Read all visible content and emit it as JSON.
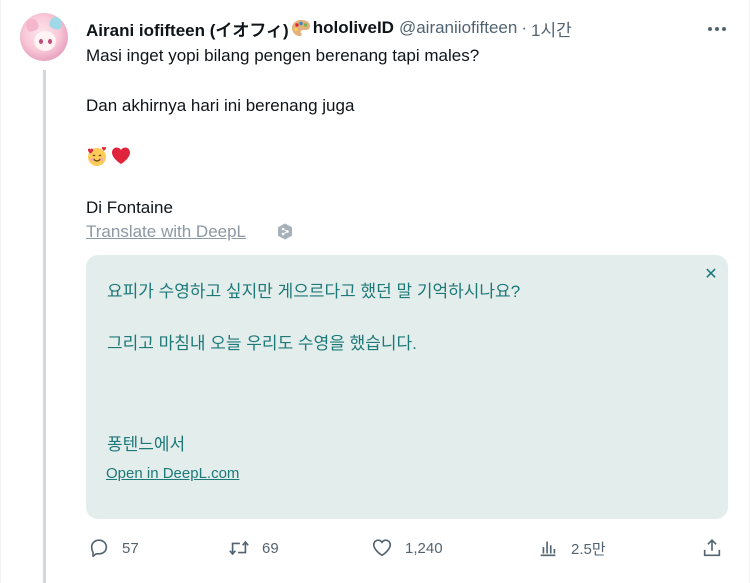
{
  "post": {
    "author_name": "Airani iofifteen (イオフィ)",
    "author_suffix": "hololiveID",
    "handle": "@airaniiofifteen",
    "separator": "·",
    "time": "1시간",
    "text_lines": [
      "Masi inget yopi bilang pengen berenang tapi males?",
      "Dan akhirnya hari ini berenang juga",
      "Di Fontaine"
    ],
    "translate_link": "Translate with DeepL"
  },
  "translation": {
    "lines": [
      "요피가 수영하고 싶지만 게으르다고 했던 말 기억하시나요?",
      "그리고 마침내 오늘 우리도 수영을 했습니다.",
      "퐁텐느에서"
    ],
    "open_link": "Open in DeepL.com",
    "close_glyph": "✕"
  },
  "actions": {
    "replies": "57",
    "reposts": "69",
    "likes": "1,240",
    "views": "2.5만"
  },
  "icons": {
    "avatar": "avatar",
    "palette": "artist-palette-icon",
    "emoji_face": "smiling-face-with-hearts-icon",
    "emoji_heart": "red-heart-icon",
    "more": "more-icon",
    "deepl": "deepl-logo-icon",
    "reply": "reply-icon",
    "repost": "repost-icon",
    "like": "heart-icon",
    "views": "views-icon",
    "share": "share-icon"
  },
  "colors": {
    "text": "#0f1419",
    "muted": "#536471",
    "translation_bg": "#e3eeec",
    "translation_text": "#1d7878",
    "heart": "#e0243c"
  }
}
